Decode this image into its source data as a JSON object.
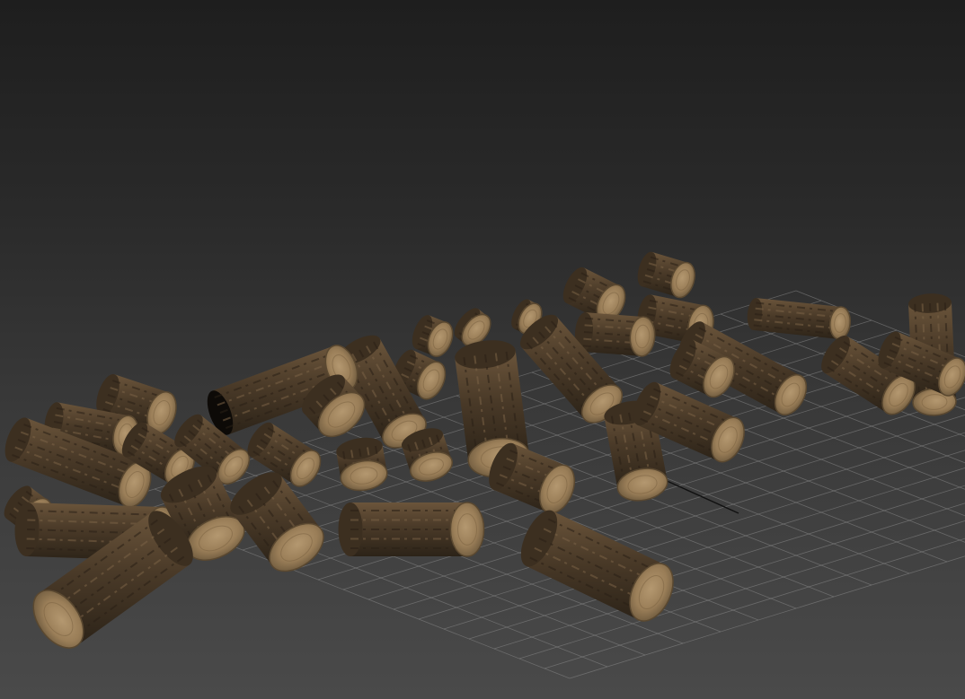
{
  "viewport": {
    "background_top": "#1e1e1e",
    "background_bottom": "#4a4a4a",
    "grid_color": "#8a8a8a",
    "axis_color": "#111111"
  },
  "scene": {
    "object_type": "firewood logs",
    "bark_color": "#4a3a28",
    "bark_highlight": "#7a6246",
    "end_grain_color": "#a68a62",
    "end_grain_ring": "#6e5a3e"
  }
}
